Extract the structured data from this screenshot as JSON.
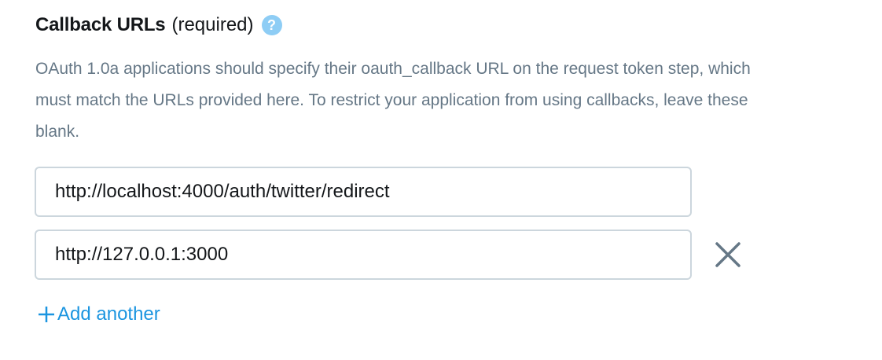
{
  "callback_section": {
    "title": "Callback URLs",
    "subtitle": "(required)",
    "help_icon_glyph": "?",
    "description": "OAuth 1.0a applications should specify their oauth_callback URL on the request token step, which must match the URLs provided here. To restrict your application from using callbacks, leave these blank.",
    "urls": [
      {
        "value": "http://localhost:4000/auth/twitter/redirect",
        "removable": false
      },
      {
        "value": "http://127.0.0.1:3000",
        "removable": true
      }
    ],
    "add_label": "Add another"
  },
  "icons": {
    "help": "question-circle-icon",
    "remove": "close-icon",
    "add": "plus-icon"
  },
  "colors": {
    "heading": "#14171a",
    "description": "#657786",
    "input_border": "#ccd6dd",
    "help_icon_bg": "#8ecdf5",
    "remove_icon": "#657786",
    "link": "#1b95e0"
  }
}
